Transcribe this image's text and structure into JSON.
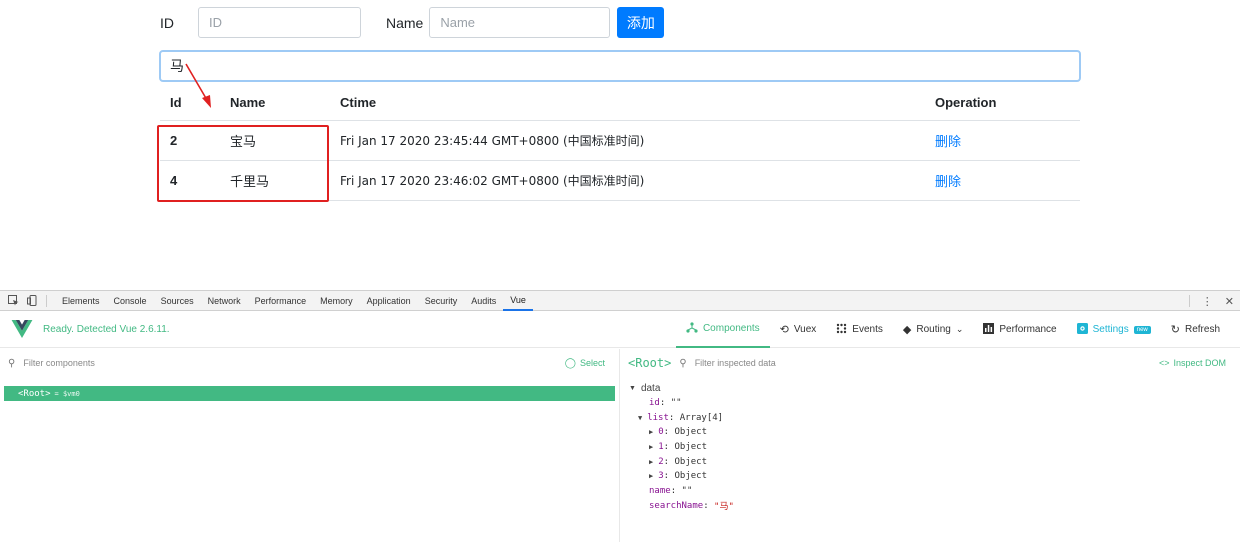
{
  "form": {
    "id_label": "ID",
    "id_placeholder": "ID",
    "name_label": "Name",
    "name_placeholder": "Name",
    "add_button": "添加"
  },
  "search": {
    "value": "马"
  },
  "table": {
    "headers": {
      "id": "Id",
      "name": "Name",
      "ctime": "Ctime",
      "operation": "Operation"
    },
    "rows": [
      {
        "id": "2",
        "name": "宝马",
        "ctime": "Fri Jan 17 2020 23:45:44 GMT+0800 (中国标准时间)",
        "op": "删除"
      },
      {
        "id": "4",
        "name": "千里马",
        "ctime": "Fri Jan 17 2020 23:46:02 GMT+0800 (中国标准时间)",
        "op": "删除"
      }
    ]
  },
  "devtools": {
    "tabs": [
      "Elements",
      "Console",
      "Sources",
      "Network",
      "Performance",
      "Memory",
      "Application",
      "Security",
      "Audits",
      "Vue"
    ],
    "active_tab": "Vue",
    "vue": {
      "status": "Ready. Detected Vue 2.6.11.",
      "nav": {
        "components": "Components",
        "vuex": "Vuex",
        "events": "Events",
        "routing": "Routing",
        "performance": "Performance",
        "settings": "Settings",
        "settings_badge": "new",
        "refresh": "Refresh"
      },
      "filter_components": "Filter components",
      "select": "Select",
      "root_tag": "<Root>",
      "root_vm": "= $vm0",
      "inspected": "<Root>",
      "filter_inspected": "Filter inspected data",
      "inspect_dom": "Inspect DOM",
      "data_section": "data",
      "fields": {
        "id_key": "id",
        "id_val": "\"\"",
        "list_key": "list",
        "list_val": "Array[4]",
        "items": [
          {
            "key": "0",
            "val": "Object"
          },
          {
            "key": "1",
            "val": "Object"
          },
          {
            "key": "2",
            "val": "Object"
          },
          {
            "key": "3",
            "val": "Object"
          }
        ],
        "name_key": "name",
        "name_val": "\"\"",
        "search_key": "searchName",
        "search_val": "\"马\""
      }
    }
  },
  "colors": {
    "primary": "#007bff",
    "vue_green": "#42b983",
    "annotation_red": "#e02020"
  }
}
